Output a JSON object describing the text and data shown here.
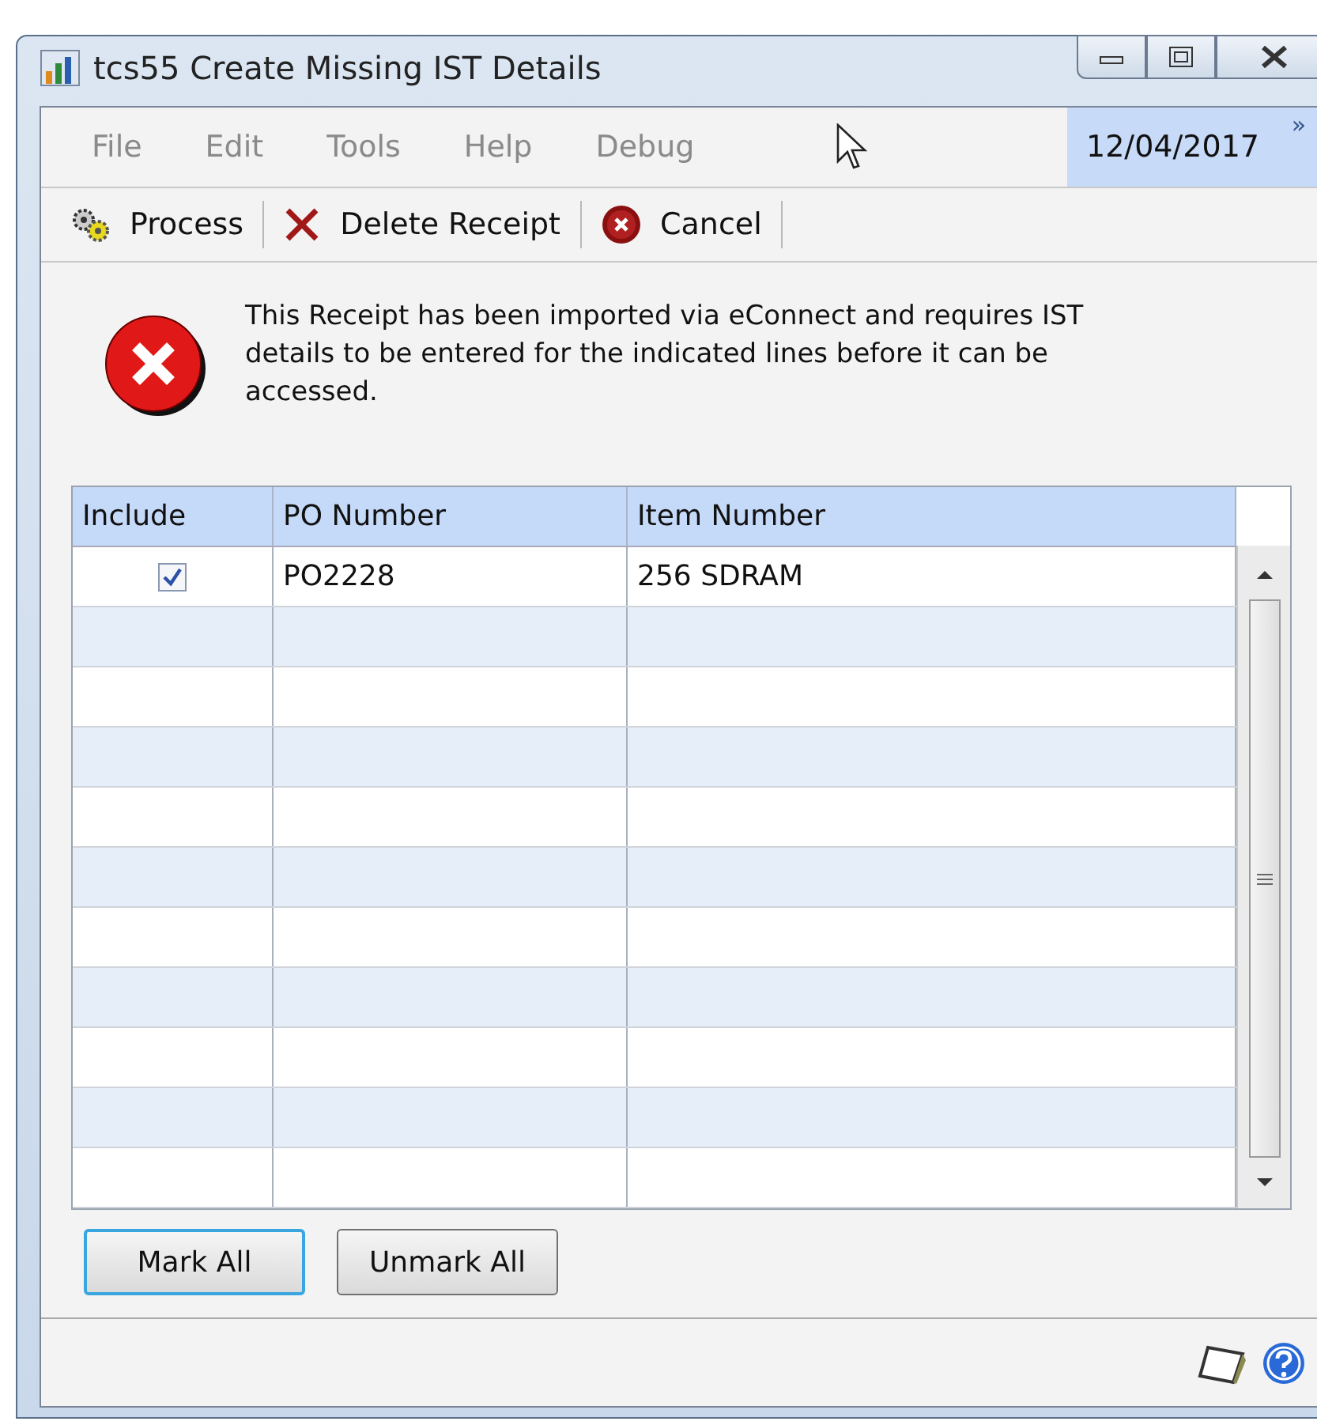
{
  "window": {
    "title": "tcs55 Create Missing IST Details"
  },
  "menu": {
    "items": [
      "File",
      "Edit",
      "Tools",
      "Help",
      "Debug"
    ],
    "date": "12/04/2017",
    "overflow": "»"
  },
  "toolbar": [
    {
      "kind": "process",
      "label": "Process"
    },
    {
      "kind": "delete",
      "label": "Delete Receipt"
    },
    {
      "kind": "cancel",
      "label": "Cancel"
    }
  ],
  "message": "This Receipt has been imported via eConnect and requires IST details to be entered for the indicated lines before it can be accessed.",
  "table": {
    "columns": [
      "Include",
      "PO Number",
      "Item Number"
    ],
    "rows": [
      {
        "include": true,
        "po_number": "PO2228",
        "item_number": "256 SDRAM"
      }
    ]
  },
  "buttons": [
    {
      "label": "Mark All",
      "focused": true
    },
    {
      "label": "Unmark All",
      "focused": false
    }
  ]
}
